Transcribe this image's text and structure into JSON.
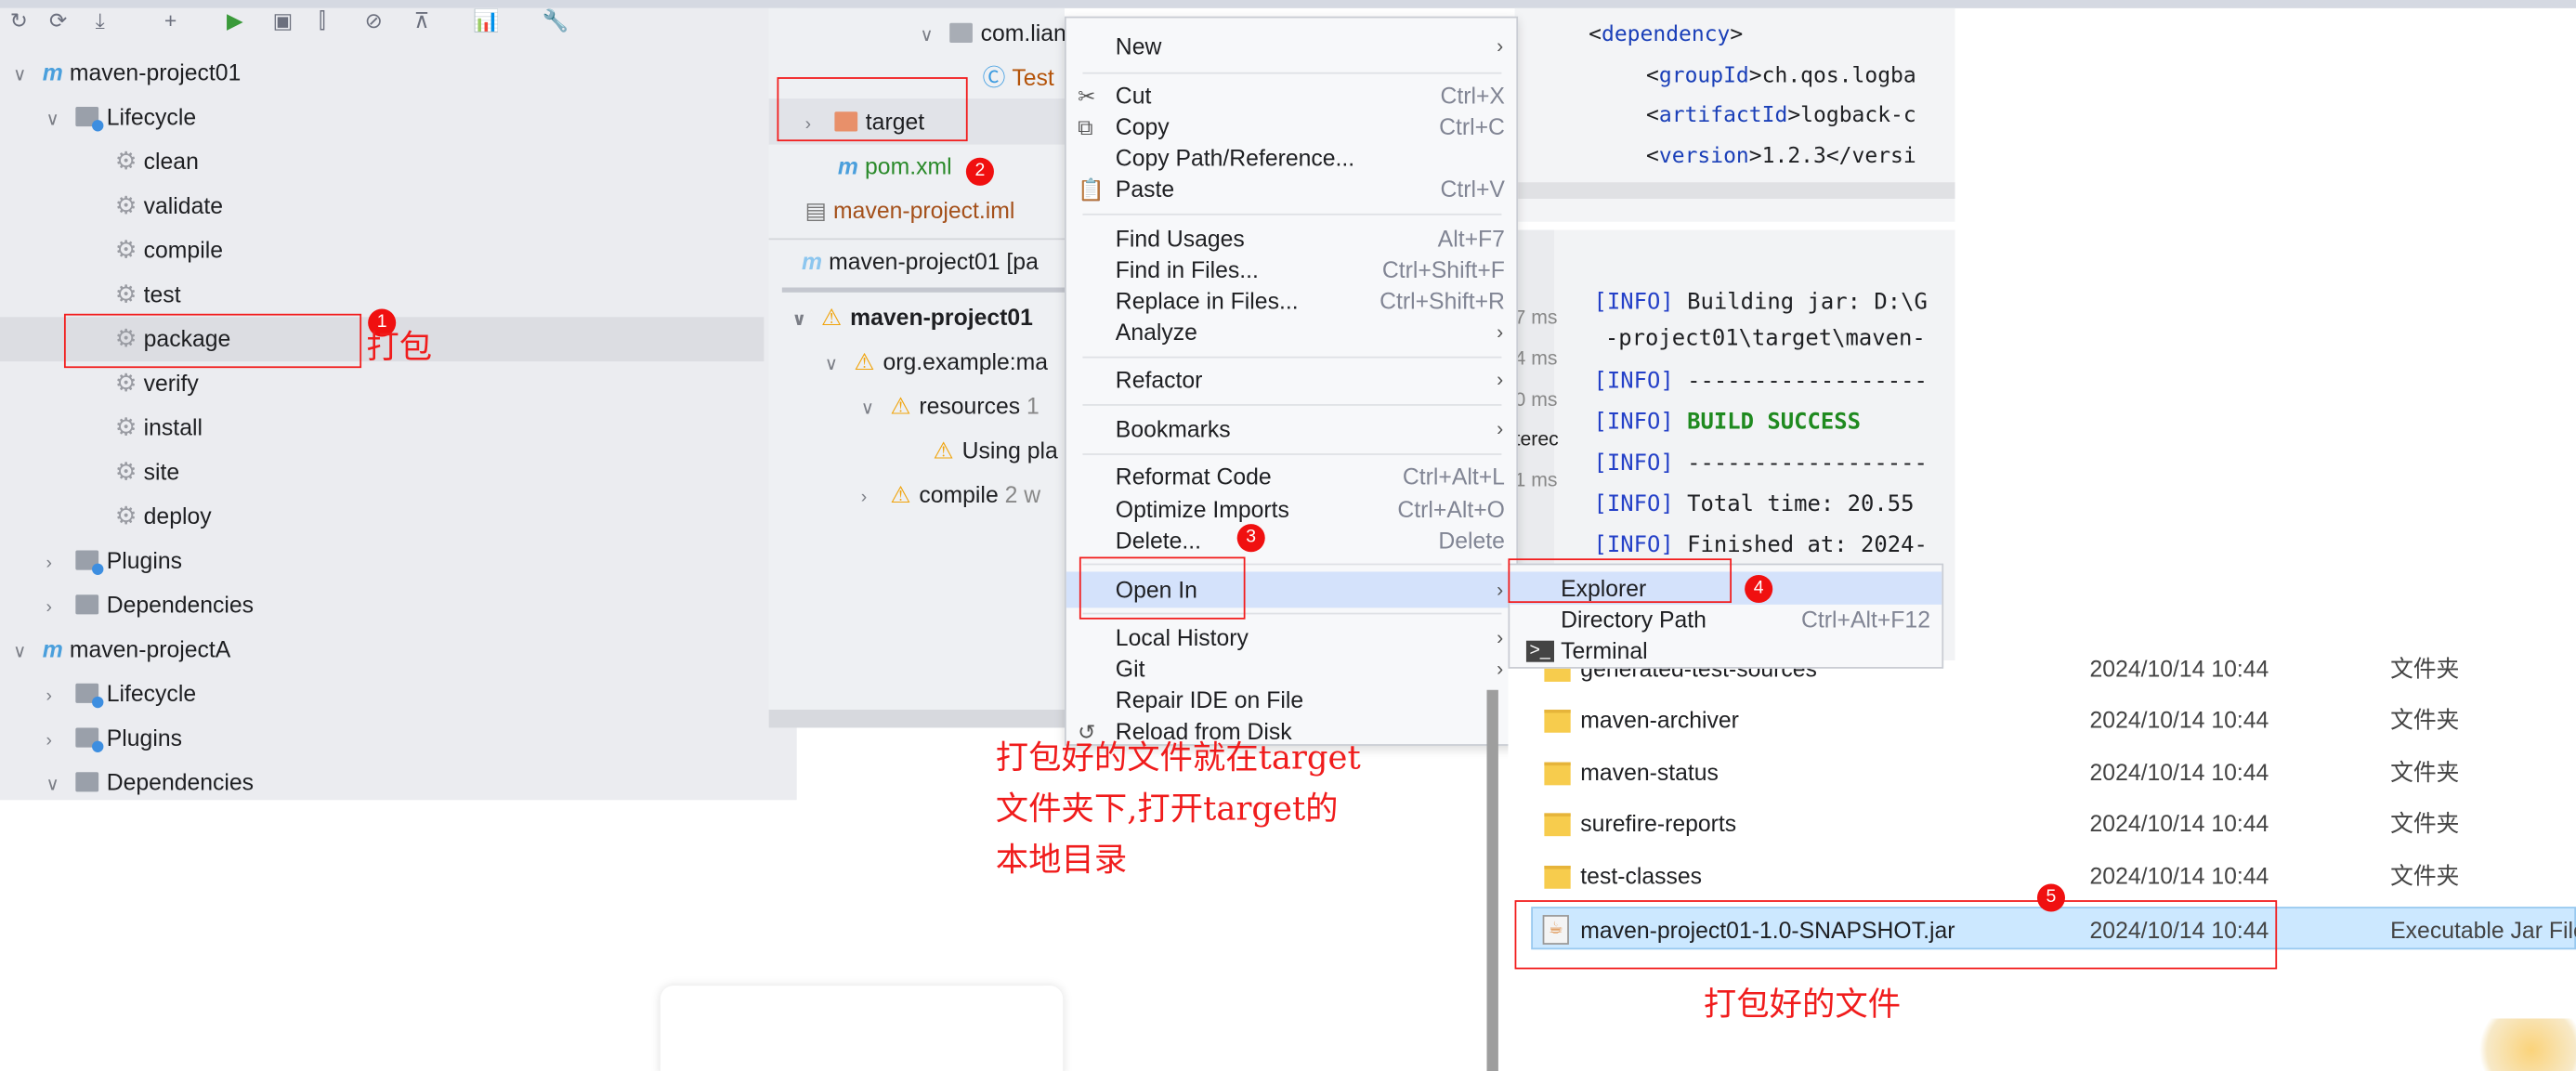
{
  "maven_panel": {
    "projects": [
      {
        "name": "maven-project01",
        "lifecycle_label": "Lifecycle",
        "tasks": [
          "clean",
          "validate",
          "compile",
          "test",
          "package",
          "verify",
          "install",
          "site",
          "deploy"
        ],
        "plugins_label": "Plugins",
        "dependencies_label": "Dependencies"
      },
      {
        "name": "maven-projectA",
        "lifecycle_label": "Lifecycle",
        "plugins_label": "Plugins",
        "dependencies_label": "Dependencies"
      }
    ]
  },
  "project_tree": {
    "package": "com.lian",
    "test_class": "Test",
    "target": "target",
    "pom": "pom.xml",
    "iml": "maven-project.iml"
  },
  "build_panel": {
    "tab": "maven-project01 [pa",
    "items": [
      "maven-project01",
      "org.example:ma",
      "resources",
      "1",
      "Using pla",
      "compile",
      "2 w"
    ]
  },
  "context_menu": {
    "items": [
      {
        "label": "New",
        "shortcut": "",
        "submenu": true
      },
      {
        "label": "Cut",
        "shortcut": "Ctrl+X"
      },
      {
        "label": "Copy",
        "shortcut": "Ctrl+C"
      },
      {
        "label": "Copy Path/Reference...",
        "shortcut": ""
      },
      {
        "label": "Paste",
        "shortcut": "Ctrl+V"
      },
      {
        "label": "Find Usages",
        "shortcut": "Alt+F7"
      },
      {
        "label": "Find in Files...",
        "shortcut": "Ctrl+Shift+F"
      },
      {
        "label": "Replace in Files...",
        "shortcut": "Ctrl+Shift+R"
      },
      {
        "label": "Analyze",
        "shortcut": "",
        "submenu": true
      },
      {
        "label": "Refactor",
        "shortcut": "",
        "submenu": true
      },
      {
        "label": "Bookmarks",
        "shortcut": "",
        "submenu": true
      },
      {
        "label": "Reformat Code",
        "shortcut": "Ctrl+Alt+L"
      },
      {
        "label": "Optimize Imports",
        "shortcut": "Ctrl+Alt+O"
      },
      {
        "label": "Delete...",
        "shortcut": "Delete"
      },
      {
        "label": "Open In",
        "shortcut": "",
        "submenu": true
      },
      {
        "label": "Local History",
        "shortcut": "",
        "submenu": true
      },
      {
        "label": "Git",
        "shortcut": "",
        "submenu": true
      },
      {
        "label": "Repair IDE on File",
        "shortcut": ""
      },
      {
        "label": "Reload from Disk",
        "shortcut": ""
      }
    ]
  },
  "submenu": {
    "items": [
      {
        "label": "Explorer",
        "shortcut": ""
      },
      {
        "label": "Directory Path",
        "shortcut": "Ctrl+Alt+F12"
      },
      {
        "label": "Terminal",
        "shortcut": ""
      }
    ]
  },
  "editor": {
    "lines": [
      [
        "<",
        "dependency",
        ">",
        ""
      ],
      [
        "<",
        "groupId",
        ">",
        "ch.qos.logba"
      ],
      [
        "<",
        "artifactId",
        ">",
        "logback-c"
      ],
      [
        "<",
        "version",
        ">",
        "1.2.3</versi"
      ]
    ]
  },
  "console": {
    "times": [
      "7 ms",
      "4 ms",
      "0 ms",
      "terec",
      "1 ms"
    ],
    "prefix": "[INFO]",
    "lines": [
      "Building jar: D:\\G",
      "-project01\\target\\maven-",
      "------------------",
      "BUILD SUCCESS",
      "------------------",
      "Total time:  20.55",
      "Finished at: 2024-"
    ]
  },
  "explorer": {
    "rows": [
      {
        "name": "generated-test-sources",
        "date": "2024/10/14 10:44",
        "type": "文件夹"
      },
      {
        "name": "maven-archiver",
        "date": "2024/10/14 10:44",
        "type": "文件夹"
      },
      {
        "name": "maven-status",
        "date": "2024/10/14 10:44",
        "type": "文件夹"
      },
      {
        "name": "surefire-reports",
        "date": "2024/10/14 10:44",
        "type": "文件夹"
      },
      {
        "name": "test-classes",
        "date": "2024/10/14 10:44",
        "type": "文件夹"
      },
      {
        "name": "maven-project01-1.0-SNAPSHOT.jar",
        "date": "2024/10/14 10:44",
        "type": "Executable Jar File"
      }
    ]
  },
  "annotations": {
    "badges": [
      "1",
      "2",
      "3",
      "4",
      "5"
    ],
    "package_note": "打包",
    "middle_note": [
      "打包好的文件就在target",
      "文件夹下,打开target的",
      "本地目录"
    ],
    "file_note": "打包好的文件"
  }
}
